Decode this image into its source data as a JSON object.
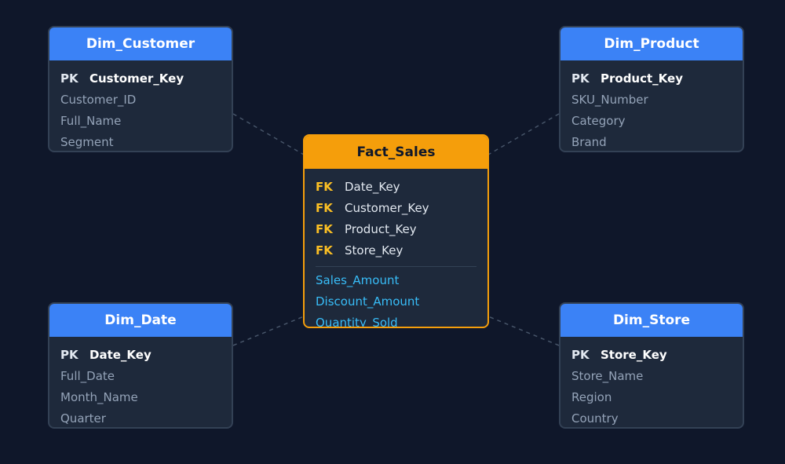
{
  "diagram": {
    "fact": {
      "title": "Fact_Sales",
      "foreign_keys": [
        {
          "tag": "FK",
          "name": "Date_Key"
        },
        {
          "tag": "FK",
          "name": "Customer_Key"
        },
        {
          "tag": "FK",
          "name": "Product_Key"
        },
        {
          "tag": "FK",
          "name": "Store_Key"
        }
      ],
      "measures": [
        "Sales_Amount",
        "Discount_Amount",
        "Quantity_Sold"
      ]
    },
    "dim_customer": {
      "title": "Dim_Customer",
      "pk_tag": "PK",
      "pk": "Customer_Key",
      "fields": [
        "Customer_ID",
        "Full_Name",
        "Segment"
      ]
    },
    "dim_product": {
      "title": "Dim_Product",
      "pk_tag": "PK",
      "pk": "Product_Key",
      "fields": [
        "SKU_Number",
        "Category",
        "Brand"
      ]
    },
    "dim_date": {
      "title": "Dim_Date",
      "pk_tag": "PK",
      "pk": "Date_Key",
      "fields": [
        "Full_Date",
        "Month_Name",
        "Quarter"
      ]
    },
    "dim_store": {
      "title": "Dim_Store",
      "pk_tag": "PK",
      "pk": "Store_Key",
      "fields": [
        "Store_Name",
        "Region",
        "Country"
      ]
    },
    "colors": {
      "background": "#0f172a",
      "dimension_header": "#3b82f6",
      "fact_header": "#f59e0b",
      "card": "#1e293b",
      "measure_text": "#38bdf8",
      "fk_tag": "#fbbf24",
      "connector": "#475569"
    }
  }
}
